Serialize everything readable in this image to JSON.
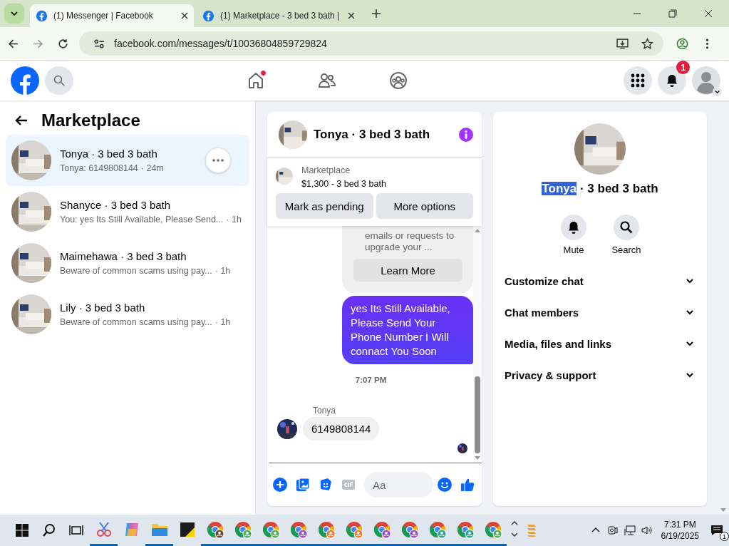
{
  "browser": {
    "tabs": [
      {
        "title": "(1) Messenger | Facebook",
        "selected": true
      },
      {
        "title": "(1) Marketplace - 3 bed 3 bath |",
        "selected": false
      }
    ],
    "url": "facebook.com/messages/t/10036804859729824"
  },
  "header": {
    "home_dot": true,
    "notifications_badge": "1"
  },
  "sidebar": {
    "title": "Marketplace",
    "chats": [
      {
        "name": "Tonya · 3 bed 3 bath",
        "preview": "Tonya: 6149808144",
        "time": "· 24m",
        "selected": true
      },
      {
        "name": "Shanyce · 3 bed 3 bath",
        "preview": "You: yes Its Still Available, Please Send...",
        "time": "· 1h",
        "selected": false
      },
      {
        "name": "Maimehawa · 3 bed 3 bath",
        "preview": "Beware of common scams using pay...",
        "time": "· 1h",
        "selected": false
      },
      {
        "name": "Lily · 3 bed 3 bath",
        "preview": "Beware of common scams using pay...",
        "time": "· 1h",
        "selected": false
      }
    ]
  },
  "chat": {
    "title": "Tonya · 3 bed 3 bath",
    "listing": {
      "source": "Marketplace",
      "price_title": "$1,300 - 3 bed 3 bath"
    },
    "actions": [
      "Mark as pending",
      "More options"
    ],
    "notice": {
      "text": "emails or requests to upgrade your ...",
      "button": "Learn More"
    },
    "sent": "yes Its Still Available, Please Send Your Phone Number I Will connact You Soon",
    "timestamp": "7:07 PM",
    "sender": "Tonya",
    "received": "6149808144",
    "composer": {
      "placeholder": "Aa"
    }
  },
  "info": {
    "title_highlight": "Tonya",
    "title_rest": " · 3 bed 3 bath",
    "actions": [
      {
        "kind": "mute",
        "label": "Mute"
      },
      {
        "kind": "search",
        "label": "Search"
      }
    ],
    "sections": [
      {
        "label": "Customize chat",
        "expanded": false
      },
      {
        "label": "Chat members",
        "expanded": false
      },
      {
        "label": "Media, files and links",
        "expanded": false
      },
      {
        "label": "Privacy & support",
        "expanded": false
      }
    ]
  },
  "taskbar": {
    "apps": [
      {
        "kind": "snip",
        "running": true
      },
      {
        "kind": "copilot",
        "running": false
      },
      {
        "kind": "folder",
        "running": true
      },
      {
        "kind": "sticky",
        "running": false
      },
      {
        "kind": "chrome",
        "color": "#6b4a2e",
        "running": true
      },
      {
        "kind": "chrome",
        "color": "#4caf50",
        "running": true
      },
      {
        "kind": "chrome",
        "color": "#4caf50",
        "running": true
      },
      {
        "kind": "chrome",
        "color": "#9c4dcc",
        "running": true
      },
      {
        "kind": "chrome",
        "color": "#f07c2e",
        "running": true
      },
      {
        "kind": "chrome",
        "color": "#f07c2e",
        "running": true
      },
      {
        "kind": "chrome",
        "color": "#9c4dcc",
        "running": true
      },
      {
        "kind": "chrome",
        "color": "#9c4dcc",
        "running": true
      },
      {
        "kind": "chrome",
        "color": "#26a69a",
        "running": true
      },
      {
        "kind": "chrome",
        "color": "#26a69a",
        "running": true
      },
      {
        "kind": "chrome",
        "color": "#4caf50",
        "running": true
      }
    ],
    "time": "7:31 PM",
    "date": "6/19/2025",
    "notifications": "1"
  }
}
